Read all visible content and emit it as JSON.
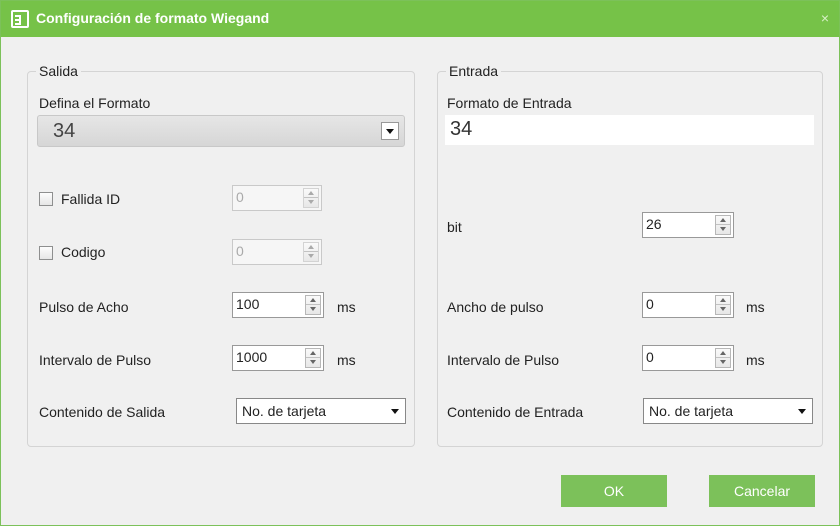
{
  "window": {
    "title": "Configuración de formato Wiegand",
    "close_glyph": "×"
  },
  "salida": {
    "legend": "Salida",
    "format_label": "Defina el Formato",
    "format_value": "34",
    "fallida_label": "Fallida ID",
    "fallida_value": "0",
    "codigo_label": "Codigo",
    "codigo_value": "0",
    "pulse_width_label": "Pulso de Acho",
    "pulse_width_value": "100",
    "pulse_width_unit": "ms",
    "pulse_interval_label": "Intervalo de Pulso",
    "pulse_interval_value": "1000",
    "pulse_interval_unit": "ms",
    "content_label": "Contenido de Salida",
    "content_value": "No. de tarjeta"
  },
  "entrada": {
    "legend": "Entrada",
    "format_label": "Formato de Entrada",
    "format_value": "34",
    "bit_label": "bit",
    "bit_value": "26",
    "pulse_width_label": "Ancho de pulso",
    "pulse_width_value": "0",
    "pulse_width_unit": "ms",
    "pulse_interval_label": "Intervalo de Pulso",
    "pulse_interval_value": "0",
    "pulse_interval_unit": "ms",
    "content_label": "Contenido de Entrada",
    "content_value": "No. de tarjeta"
  },
  "buttons": {
    "ok": "OK",
    "cancel": "Cancelar"
  },
  "colors": {
    "accent": "#76c248"
  }
}
